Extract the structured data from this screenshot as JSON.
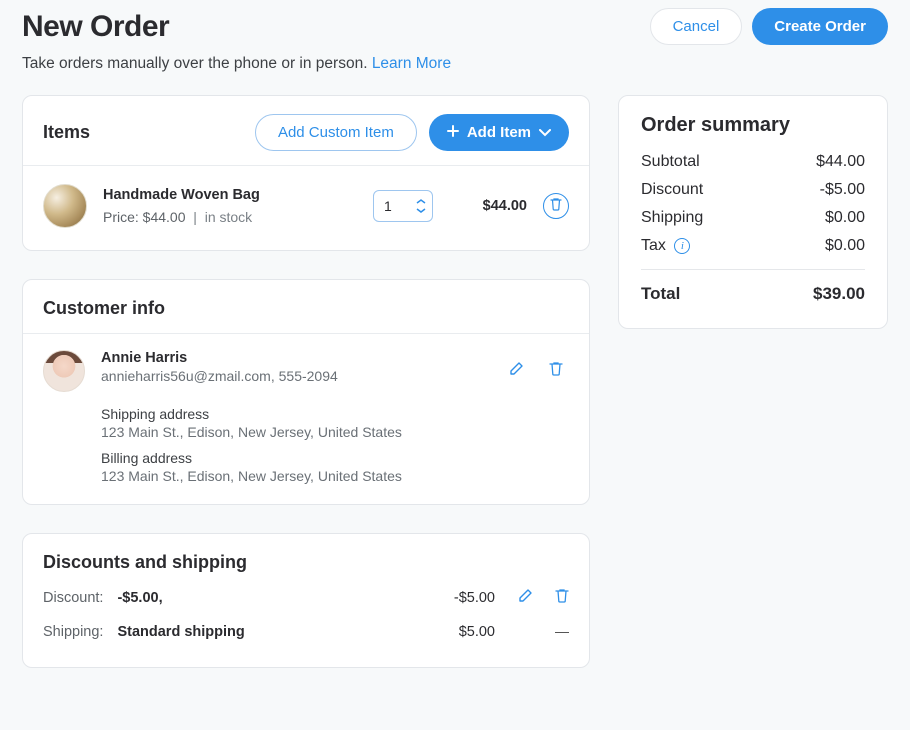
{
  "header": {
    "title": "New Order",
    "subtitle": "Take orders manually over the phone or in person.  ",
    "learn_more": "Learn More",
    "cancel": "Cancel",
    "create": "Create Order"
  },
  "items_section": {
    "title": "Items",
    "add_custom_label": "Add Custom Item",
    "add_item_label": "Add Item"
  },
  "item": {
    "name": "Handmade Woven Bag",
    "price_label": "Price: $44.00",
    "stock_label": "in stock",
    "qty": "1",
    "line_total": "$44.00"
  },
  "customer_section": {
    "title": "Customer info"
  },
  "customer": {
    "name": "Annie Harris",
    "contact": "annieharris56u@zmail.com, 555-2094",
    "ship_label": "Shipping address",
    "ship_value": "123 Main St., Edison, New Jersey, United States",
    "bill_label": "Billing address",
    "bill_value": "123 Main St., Edison, New Jersey, United States"
  },
  "discounts_section": {
    "title": "Discounts and shipping"
  },
  "discount": {
    "label": "Discount:",
    "value": "-$5.00,",
    "amount": "-$5.00"
  },
  "shipping": {
    "label": "Shipping:",
    "value": "Standard shipping",
    "amount": "$5.00"
  },
  "summary": {
    "title": "Order summary",
    "subtotal_label": "Subtotal",
    "subtotal_value": "$44.00",
    "discount_label": "Discount",
    "discount_value": "-$5.00",
    "shipping_label": "Shipping",
    "shipping_value": "$0.00",
    "tax_label": "Tax",
    "tax_value": "$0.00",
    "total_label": "Total",
    "total_value": "$39.00"
  }
}
